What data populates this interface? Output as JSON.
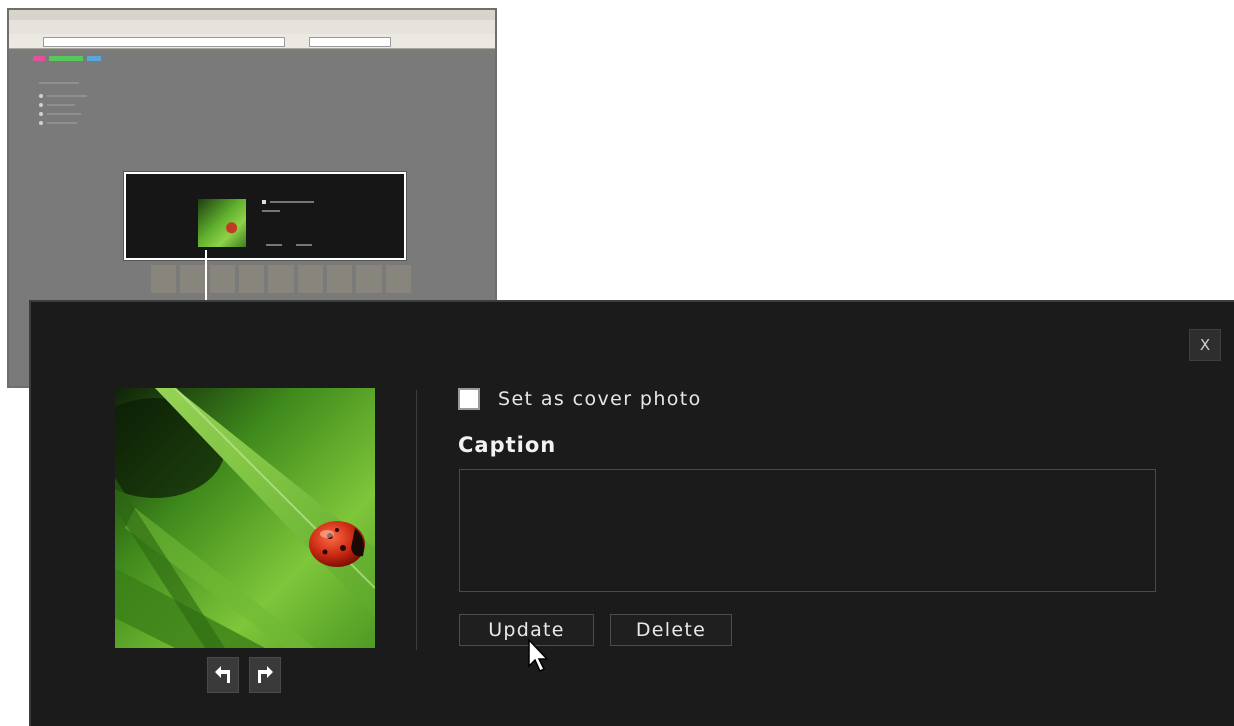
{
  "dialog": {
    "close_glyph": "X",
    "cover_photo_label": "Set as cover photo",
    "cover_photo_checked": false,
    "caption_heading": "Caption",
    "caption_value": "",
    "update_label": "Update",
    "delete_label": "Delete",
    "rotate_left_icon": "rotate-left-icon",
    "rotate_right_icon": "rotate-right-icon"
  },
  "colors": {
    "dialog_bg": "#1b1b1b",
    "page_bg": "#ffffff",
    "text": "#e6e6e6"
  }
}
